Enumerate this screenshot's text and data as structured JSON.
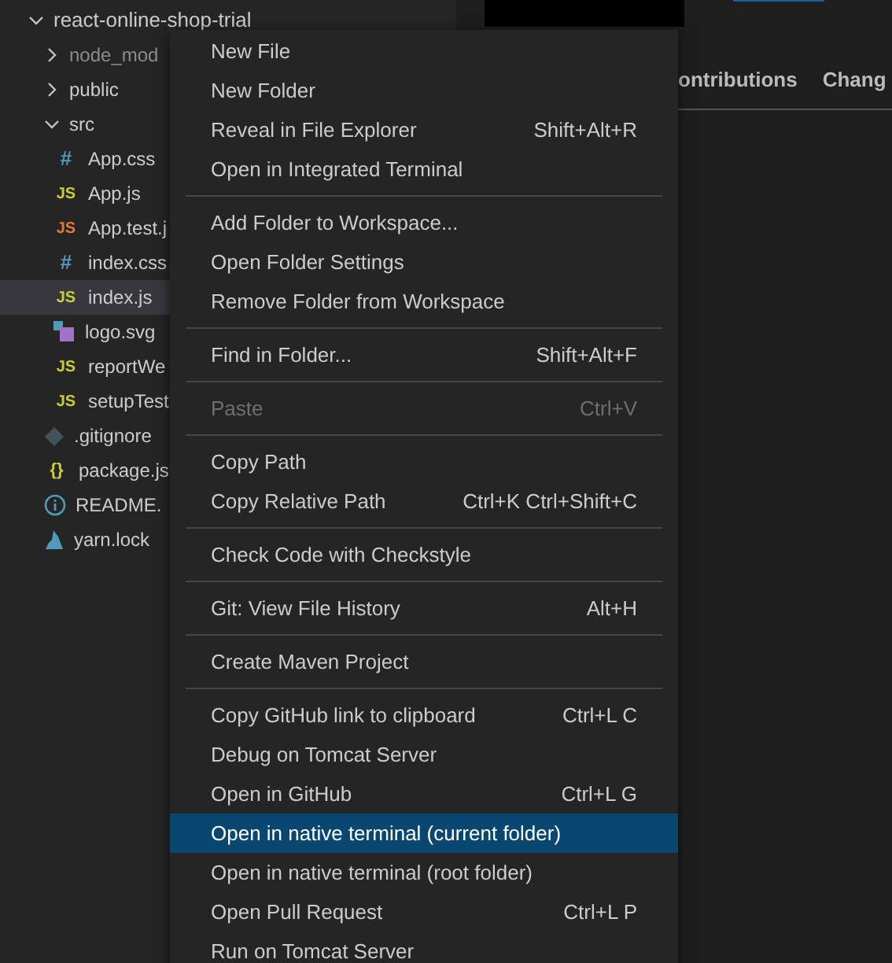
{
  "explorer": {
    "root": {
      "label": "react-online-shop-trial",
      "expanded": true
    },
    "items": [
      {
        "kind": "folder",
        "name": "node_mod",
        "expanded": false,
        "dim": true,
        "selected": false
      },
      {
        "kind": "folder",
        "name": "public",
        "expanded": false,
        "dim": false,
        "selected": false
      },
      {
        "kind": "folder",
        "name": "src",
        "expanded": true,
        "dim": false,
        "selected": false,
        "children": [
          {
            "kind": "css",
            "icon": "#",
            "name": "App.css",
            "selected": false
          },
          {
            "kind": "js",
            "icon": "JS",
            "name": "App.js",
            "selected": false
          },
          {
            "kind": "test",
            "icon": "JS",
            "name": "App.test.j",
            "selected": false
          },
          {
            "kind": "css",
            "icon": "#",
            "name": "index.css",
            "selected": false
          },
          {
            "kind": "js",
            "icon": "JS",
            "name": "index.js",
            "selected": true
          },
          {
            "kind": "svg",
            "name": "logo.svg",
            "selected": false
          },
          {
            "kind": "js",
            "icon": "JS",
            "name": "reportWe",
            "selected": false
          },
          {
            "kind": "js",
            "icon": "JS",
            "name": "setupTest",
            "selected": false
          }
        ]
      },
      {
        "kind": "git",
        "name": ".gitignore",
        "selected": false
      },
      {
        "kind": "json",
        "icon": "{}",
        "name": "package.js",
        "selected": false
      },
      {
        "kind": "info",
        "name": "README.",
        "selected": false
      },
      {
        "kind": "lock",
        "name": "yarn.lock",
        "selected": false
      }
    ]
  },
  "editor": {
    "tabs": [
      {
        "label": "ontributions"
      },
      {
        "label": "Chang"
      }
    ]
  },
  "context_menu": {
    "groups": [
      [
        {
          "label": "New File",
          "disabled": false,
          "selected": false
        },
        {
          "label": "New Folder",
          "disabled": false,
          "selected": false
        },
        {
          "label": "Reveal in File Explorer",
          "shortcut": "Shift+Alt+R",
          "disabled": false,
          "selected": false
        },
        {
          "label": "Open in Integrated Terminal",
          "disabled": false,
          "selected": false
        }
      ],
      [
        {
          "label": "Add Folder to Workspace...",
          "disabled": false,
          "selected": false
        },
        {
          "label": "Open Folder Settings",
          "disabled": false,
          "selected": false
        },
        {
          "label": "Remove Folder from Workspace",
          "disabled": false,
          "selected": false
        }
      ],
      [
        {
          "label": "Find in Folder...",
          "shortcut": "Shift+Alt+F",
          "disabled": false,
          "selected": false
        }
      ],
      [
        {
          "label": "Paste",
          "shortcut": "Ctrl+V",
          "disabled": true,
          "selected": false
        }
      ],
      [
        {
          "label": "Copy Path",
          "disabled": false,
          "selected": false
        },
        {
          "label": "Copy Relative Path",
          "shortcut": "Ctrl+K Ctrl+Shift+C",
          "disabled": false,
          "selected": false
        }
      ],
      [
        {
          "label": "Check Code with Checkstyle",
          "disabled": false,
          "selected": false
        }
      ],
      [
        {
          "label": "Git: View File History",
          "shortcut": "Alt+H",
          "disabled": false,
          "selected": false
        }
      ],
      [
        {
          "label": "Create Maven Project",
          "disabled": false,
          "selected": false
        }
      ],
      [
        {
          "label": "Copy GitHub link to clipboard",
          "shortcut": "Ctrl+L C",
          "disabled": false,
          "selected": false
        },
        {
          "label": "Debug on Tomcat Server",
          "disabled": false,
          "selected": false
        },
        {
          "label": "Open in GitHub",
          "shortcut": "Ctrl+L G",
          "disabled": false,
          "selected": false
        },
        {
          "label": "Open in native terminal (current folder)",
          "disabled": false,
          "selected": true
        },
        {
          "label": "Open in native terminal (root folder)",
          "disabled": false,
          "selected": false
        },
        {
          "label": "Open Pull Request",
          "shortcut": "Ctrl+L P",
          "disabled": false,
          "selected": false
        },
        {
          "label": "Run on Tomcat Server",
          "disabled": false,
          "selected": false
        }
      ]
    ]
  }
}
